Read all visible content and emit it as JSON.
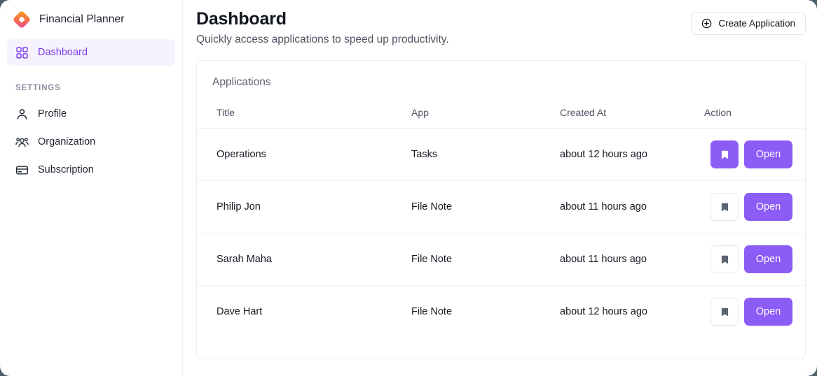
{
  "brand": {
    "name": "Financial Planner",
    "logo_icon": "diamond-logo-icon",
    "colors": {
      "gradient_from": "#f59e0b",
      "gradient_to": "#ec4899"
    }
  },
  "sidebar": {
    "primary_items": [
      {
        "label": "Dashboard",
        "icon": "grid-icon",
        "active": true
      }
    ],
    "section_label": "SETTINGS",
    "settings_items": [
      {
        "label": "Profile",
        "icon": "user-icon"
      },
      {
        "label": "Organization",
        "icon": "users-group-icon"
      },
      {
        "label": "Subscription",
        "icon": "credit-card-icon"
      }
    ]
  },
  "header": {
    "title": "Dashboard",
    "subtitle": "Quickly access applications to speed up productivity.",
    "create_button": {
      "label": "Create Application",
      "icon": "plus-circle-icon"
    }
  },
  "card": {
    "title": "Applications",
    "columns": [
      "Title",
      "App",
      "Created At",
      "Action"
    ],
    "rows": [
      {
        "title": "Operations",
        "app": "Tasks",
        "created_at": "about 12 hours ago",
        "bookmarked": true,
        "bookmark_icon": "bookmark-icon",
        "open_label": "Open"
      },
      {
        "title": "Philip Jon",
        "app": "File Note",
        "created_at": "about 11 hours ago",
        "bookmarked": false,
        "bookmark_icon": "bookmark-icon",
        "open_label": "Open"
      },
      {
        "title": "Sarah Maha",
        "app": "File Note",
        "created_at": "about 11 hours ago",
        "bookmarked": false,
        "bookmark_icon": "bookmark-icon",
        "open_label": "Open"
      },
      {
        "title": "Dave Hart",
        "app": "File Note",
        "created_at": "about 12 hours ago",
        "bookmarked": false,
        "bookmark_icon": "bookmark-icon",
        "open_label": "Open"
      }
    ]
  },
  "theme": {
    "accent": "#8b5cf6",
    "accent_text": "#7c3aed",
    "active_nav_bg": "#f6f3ff",
    "border": "#eceef2"
  }
}
